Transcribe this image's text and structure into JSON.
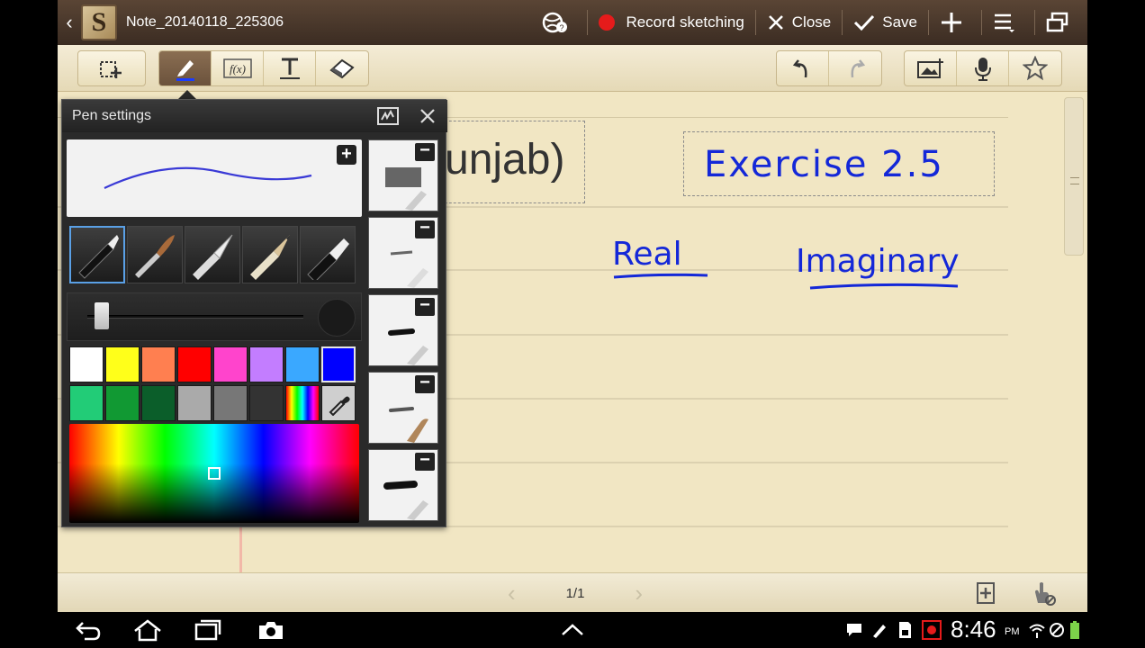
{
  "titlebar": {
    "note_title": "Note_20140118_225306",
    "record_label": "Record sketching",
    "close_label": "Close",
    "save_label": "Save"
  },
  "toolbar": {
    "tools": [
      "selection-mode",
      "pen",
      "formula",
      "text",
      "eraser"
    ],
    "right_tools": [
      "undo",
      "redo",
      "insert-image",
      "voice-record",
      "favorite"
    ]
  },
  "canvas": {
    "typed_text": "unjab)",
    "handwriting": {
      "exercise": "Exercise 2.5",
      "real": "Real",
      "imaginary": "Imaginary"
    }
  },
  "pen_settings": {
    "title": "Pen settings",
    "selected_color": "#0000ff",
    "stroke_color": "#3a3ad6",
    "size_level": 0.05,
    "colors_row1": [
      "#ffffff",
      "#ffff1a",
      "#ff7f50",
      "#ff0000",
      "#ff44cc",
      "#c37dff",
      "#3aa8ff",
      "#0000ff"
    ],
    "colors_row2": [
      "#22cc77",
      "#119933",
      "#0b5e2a",
      "#aaaaaa",
      "#777777",
      "#333333"
    ]
  },
  "pagebar": {
    "page_indicator": "1/1"
  },
  "statusbar": {
    "time": "8:46",
    "ampm": "PM"
  }
}
